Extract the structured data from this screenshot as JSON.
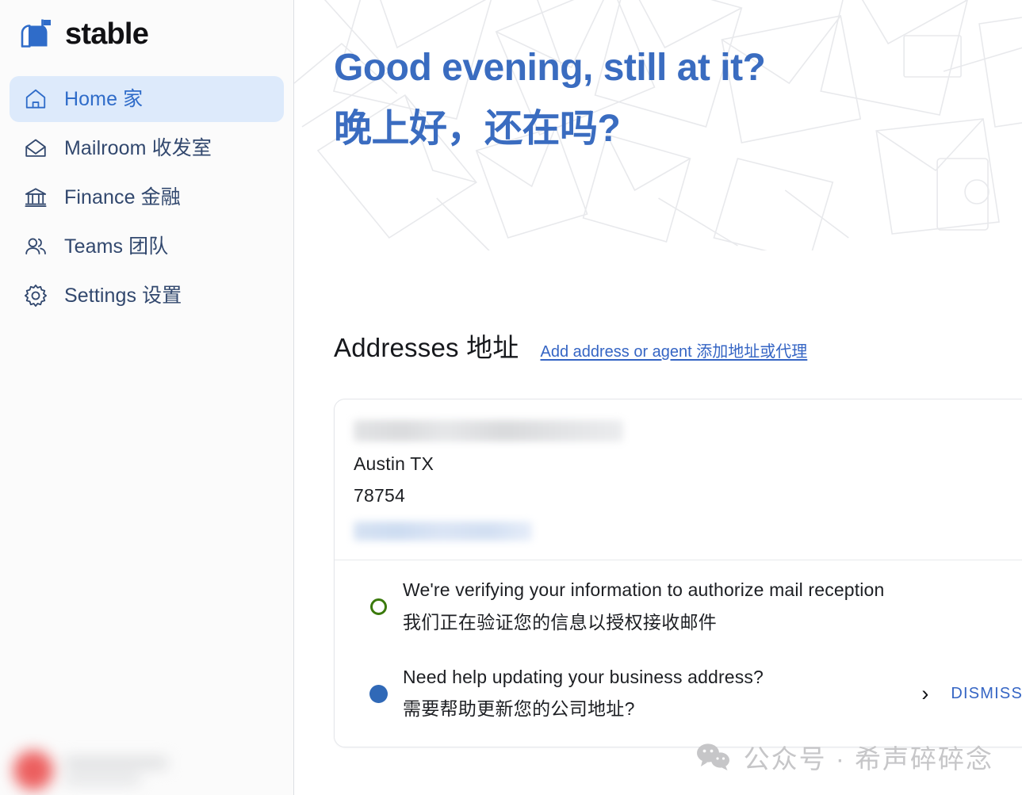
{
  "brand": {
    "name": "stable",
    "logo_icon": "mailbox-icon",
    "logo_color": "#2f6cc9"
  },
  "sidebar": {
    "items": [
      {
        "label": "Home 家",
        "icon": "home-icon",
        "active": true
      },
      {
        "label": "Mailroom 收发室",
        "icon": "envelope-icon",
        "active": false
      },
      {
        "label": "Finance 金融",
        "icon": "bank-icon",
        "active": false
      },
      {
        "label": "Teams 团队",
        "icon": "people-icon",
        "active": false
      },
      {
        "label": "Settings 设置",
        "icon": "gear-icon",
        "active": false
      }
    ],
    "active_bg": "#ddeafb",
    "active_fg": "#2f6cc9",
    "user_account": {
      "redacted": true,
      "avatar_color": "#ec5f5f"
    }
  },
  "hero": {
    "greeting_en": "Good evening, still at it?",
    "greeting_zh": "晚上好，还在吗?",
    "color": "#3a6cc0",
    "background": "envelope-line-art-pattern"
  },
  "addresses": {
    "title": "Addresses 地址",
    "add_link": "Add address or agent 添加地址或代理",
    "link_color": "#3565c4",
    "card": {
      "street_redacted": true,
      "city_state": "Austin  TX",
      "postal_code": "78754",
      "action_link_redacted": true
    },
    "notifications": [
      {
        "status": "pending",
        "dot_style": "outline",
        "dot_color": "#3b7a0c",
        "text_en": "We're verifying your information to authorize mail reception",
        "text_zh": "我们正在验证您的信息以授权接收邮件",
        "has_actions": false
      },
      {
        "status": "info",
        "dot_style": "filled",
        "dot_color": "#3069b7",
        "text_en": "Need help updating your business address?",
        "text_zh": "需要帮助更新您的公司地址?",
        "has_actions": true,
        "chevron": "›",
        "dismiss_label": "DISMISS"
      }
    ]
  },
  "watermark": {
    "text": "公众号 · 希声碎碎念",
    "icon": "wechat-icon",
    "color": "#c6c6c8"
  }
}
